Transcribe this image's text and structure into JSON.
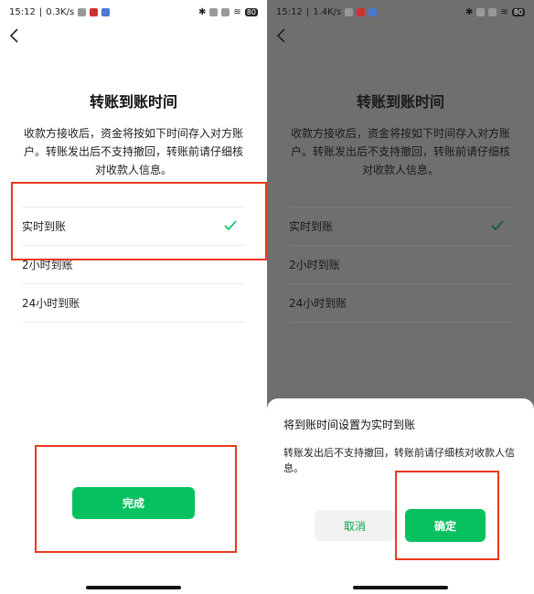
{
  "left": {
    "status": {
      "time": "15:12",
      "speed": "0.3K/s",
      "battery": "80"
    },
    "title": "转账到账时间",
    "description_lines": [
      "收款方接收后，资金将按如下时间存入对方账",
      "户。转账发出后不支持撤回，转账前请仔细核",
      "对收款人信息。"
    ],
    "options": [
      "实时到账",
      "2小时到账",
      "24小时到账"
    ],
    "done_label": "完成"
  },
  "right": {
    "status": {
      "time": "15:12",
      "speed": "1.4K/s",
      "battery": "80"
    },
    "title": "转账到账时间",
    "description_lines": [
      "收款方接收后，资金将按如下时间存入对方账",
      "户。转账发出后不支持撤回，转账前请仔细核",
      "对收款人信息。"
    ],
    "options": [
      "实时到账",
      "2小时到账",
      "24小时到账"
    ],
    "dialog": {
      "title": "将到账时间设置为实时到账",
      "message": "转账发出后不支持撤回，转账前请仔细核对收款人信息。",
      "cancel": "取消",
      "confirm": "确定"
    }
  },
  "colors": {
    "accent": "#07c160",
    "highlight": "#e8391d",
    "overlay": "#6f6f6f"
  },
  "selected_option_index": 0
}
